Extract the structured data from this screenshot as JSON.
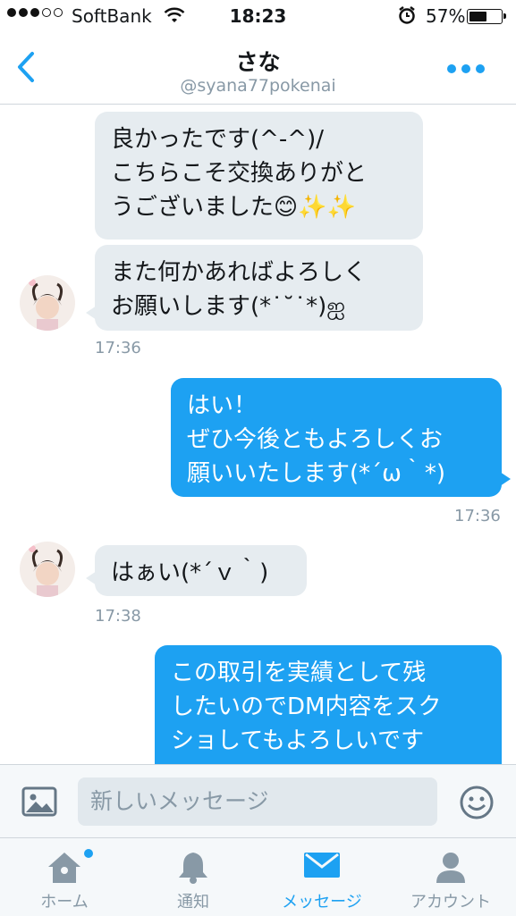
{
  "status": {
    "carrier": "SoftBank",
    "time": "18:23",
    "battery": "57%",
    "battery_level": 0.57
  },
  "header": {
    "name": "さな",
    "handle": "@syana77pokenai"
  },
  "messages": [
    {
      "side": "in",
      "text": "良かったです(^-^)/\nこちらこそ交換ありがと\nうございました😊✨✨"
    },
    {
      "side": "in",
      "text": "また何かあればよろしく\nお願いします(*˙˘˙*)ஐ",
      "time": "17:36"
    },
    {
      "side": "out",
      "text": "はい！\nぜひ今後ともよろしくお\n願いいたします(*´ω｀*)",
      "time": "17:36"
    },
    {
      "side": "in",
      "text": "はぁい(*´ｖ｀)",
      "time": "17:38"
    },
    {
      "side": "out",
      "text": "この取引を実績として残\nしたいのでDM内容をスク\nショしてもよろしいです"
    }
  ],
  "compose": {
    "placeholder": "新しいメッセージ"
  },
  "tabs": [
    {
      "label": "ホーム",
      "icon": "home-icon"
    },
    {
      "label": "通知",
      "icon": "bell-icon"
    },
    {
      "label": "メッセージ",
      "icon": "envelope-icon"
    },
    {
      "label": "アカウント",
      "icon": "person-icon"
    }
  ],
  "colors": {
    "accent": "#1da1f2",
    "incoming": "#e6ecf0",
    "muted": "#8899a6"
  }
}
